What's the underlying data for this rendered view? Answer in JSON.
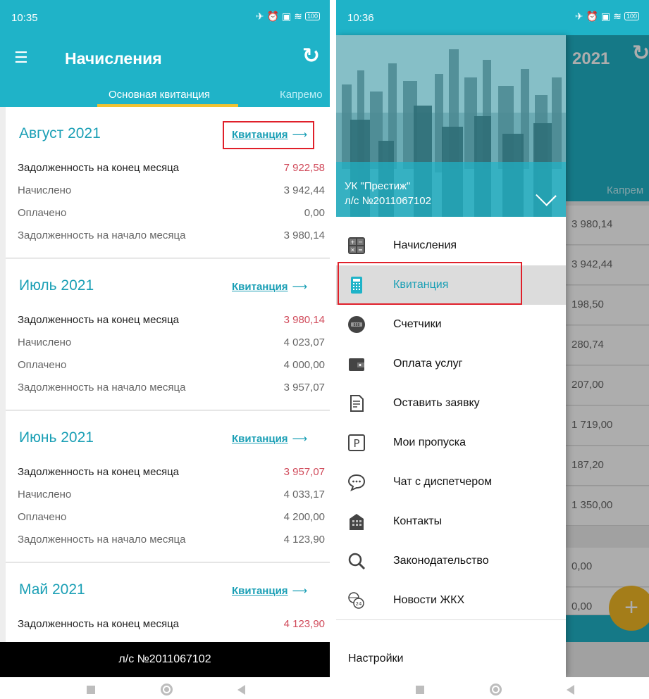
{
  "left_screen": {
    "status_time": "10:35",
    "status_icons": "✈⏰▣≋",
    "battery": "100",
    "title": "Начисления",
    "tabs": [
      "Основная квитанция",
      "Капремонт"
    ],
    "tab2_visible": "Капремо",
    "cards": [
      {
        "month": "Август 2021",
        "link": "Квитанция",
        "rows": [
          {
            "label": "Задолженность на конец месяца",
            "value": "7 922,58"
          },
          {
            "label": "Начислено",
            "value": "3 942,44"
          },
          {
            "label": "Оплачено",
            "value": "0,00"
          },
          {
            "label": "Задолженность на начало месяца",
            "value": "3 980,14"
          }
        ]
      },
      {
        "month": "Июль 2021",
        "link": "Квитанция",
        "rows": [
          {
            "label": "Задолженность на конец месяца",
            "value": "3 980,14"
          },
          {
            "label": "Начислено",
            "value": "4 023,07"
          },
          {
            "label": "Оплачено",
            "value": "4 000,00"
          },
          {
            "label": "Задолженность на начало месяца",
            "value": "3 957,07"
          }
        ]
      },
      {
        "month": "Июнь 2021",
        "link": "Квитанция",
        "rows": [
          {
            "label": "Задолженность на конец месяца",
            "value": "3 957,07"
          },
          {
            "label": "Начислено",
            "value": "4 033,17"
          },
          {
            "label": "Оплачено",
            "value": "4 200,00"
          },
          {
            "label": "Задолженность на начало месяца",
            "value": "4 123,90"
          }
        ]
      },
      {
        "month": "Май 2021",
        "link": "Квитанция",
        "rows": [
          {
            "label": "Задолженность на конец месяца",
            "value": "4 123,90"
          }
        ]
      }
    ],
    "account_bar": "л/с №2011067102"
  },
  "right_screen": {
    "status_time": "10:36",
    "status_icons": "✈⏰▣≋",
    "battery": "100",
    "background": {
      "year_fragment": "2021",
      "tab_fragment": "Капрем",
      "values": [
        "3 980,14",
        "3 942,44",
        "198,50",
        "280,74",
        "207,00",
        "1 719,00",
        "187,20",
        "1 350,00",
        "0,00",
        "0,00"
      ],
      "fab": "+"
    },
    "drawer": {
      "org": "УК \"Престиж\"",
      "account": "л/с №2011067102",
      "items": [
        {
          "label": "Начисления",
          "icon": "calculator-icon"
        },
        {
          "label": "Квитанция",
          "icon": "receipt-icon"
        },
        {
          "label": "Счетчики",
          "icon": "meter-icon"
        },
        {
          "label": "Оплата услуг",
          "icon": "wallet-icon"
        },
        {
          "label": "Оставить заявку",
          "icon": "request-document-icon"
        },
        {
          "label": "Мои пропуска",
          "icon": "parking-pass-icon"
        },
        {
          "label": "Чат с диспетчером",
          "icon": "chat-icon"
        },
        {
          "label": "Контакты",
          "icon": "building-icon"
        },
        {
          "label": "Законодательство",
          "icon": "magnifier-icon"
        },
        {
          "label": "Новости ЖКХ",
          "icon": "news-globe-icon"
        }
      ],
      "settings": "Настройки"
    }
  },
  "colors": {
    "primary": "#1fb3c8",
    "accent": "#f2c230",
    "debt": "#d04a5a",
    "link": "#1a9fb5",
    "highlight": "#e0202a"
  }
}
